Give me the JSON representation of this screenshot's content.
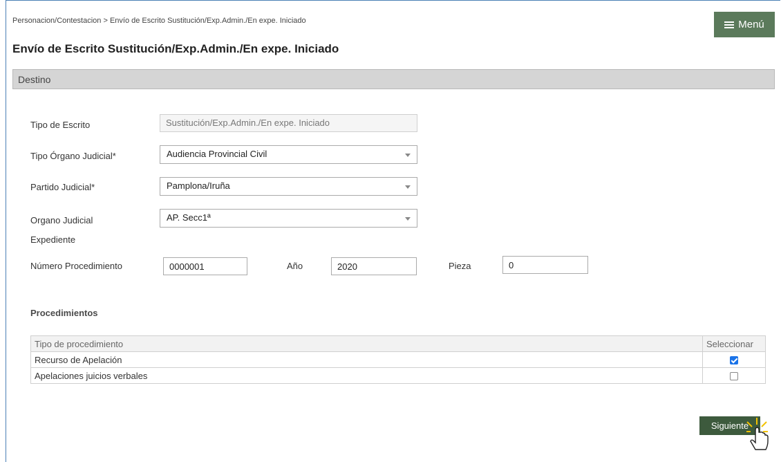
{
  "breadcrumb": "Personacion/Contestacion > Envío de Escrito Sustitución/Exp.Admin./En expe. Iniciado",
  "menu_label": "Menú",
  "page_title": "Envío de Escrito Sustitución/Exp.Admin./En expe. Iniciado",
  "section_title": "Destino",
  "form": {
    "tipo_escrito": {
      "label": "Tipo de Escrito",
      "value": "Sustitución/Exp.Admin./En expe. Iniciado"
    },
    "tipo_organo": {
      "label": "Tipo Órgano Judicial*",
      "value": "Audiencia Provincial Civil"
    },
    "partido": {
      "label": "Partido Judicial*",
      "value": "Pamplona/Iruña"
    },
    "organo": {
      "label": "Organo Judicial",
      "value": "AP. Secc1ª"
    },
    "expediente_label": "Expediente",
    "numero": {
      "label": "Número Procedimiento",
      "value": "0000001"
    },
    "anio": {
      "label": "Año",
      "value": "2020"
    },
    "pieza": {
      "label": "Pieza",
      "value": "0"
    }
  },
  "procedimientos": {
    "title": "Procedimientos",
    "columns": [
      "Tipo de procedimiento",
      "Seleccionar"
    ],
    "rows": [
      {
        "name": "Recurso de Apelación",
        "selected": true
      },
      {
        "name": "Apelaciones juicios verbales",
        "selected": false
      }
    ]
  },
  "next_label": "Siguiente",
  "colors": {
    "menu_button": "#5b7a5b",
    "next_button": "#3d5a3d",
    "section_bar": "#d5d5d5",
    "checkbox_on": "#1a73e8"
  },
  "icons": {
    "menu": "hamburger-icon",
    "cursor": "hand-pointer-icon",
    "dropdown": "caret-down-icon"
  }
}
